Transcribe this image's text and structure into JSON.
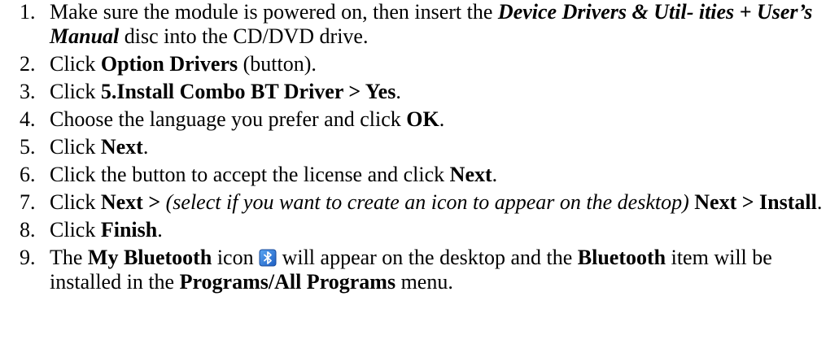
{
  "steps": [
    {
      "num": "1.",
      "parts": [
        "Make sure the module is powered on, then insert the ",
        "Device Drivers & Util- ities + User’s Manual",
        " disc into the CD/DVD drive."
      ]
    },
    {
      "num": "2.",
      "parts": [
        "Click ",
        "Option Drivers",
        " (button)."
      ]
    },
    {
      "num": "3.",
      "parts": [
        "Click ",
        "5.Install Combo BT Driver > Yes",
        "."
      ]
    },
    {
      "num": "4.",
      "parts": [
        "Choose the language you prefer and click ",
        "OK",
        "."
      ]
    },
    {
      "num": "5.",
      "parts": [
        "Click ",
        "Next",
        "."
      ]
    },
    {
      "num": "6.",
      "parts": [
        "Click the button to accept the license and click ",
        "Next",
        "."
      ]
    },
    {
      "num": "7.",
      "parts": [
        "Click ",
        "Next >",
        " ",
        "(select if you want to create an icon to appear on the desktop)",
        " ",
        "Next > Install",
        "."
      ]
    },
    {
      "num": "8.",
      "parts": [
        "Click ",
        "Finish",
        "."
      ]
    },
    {
      "num": "9.",
      "parts": [
        "The ",
        "My Bluetooth",
        " icon ",
        " will appear on the desktop and the ",
        "Bluetooth",
        " item will be installed in the ",
        "Programs/All Programs",
        " menu."
      ],
      "icon": "bluetooth-icon"
    }
  ],
  "colors": {
    "text": "#000000",
    "icon_bg": "#1e6fd9",
    "icon_fg": "#ffffff"
  }
}
